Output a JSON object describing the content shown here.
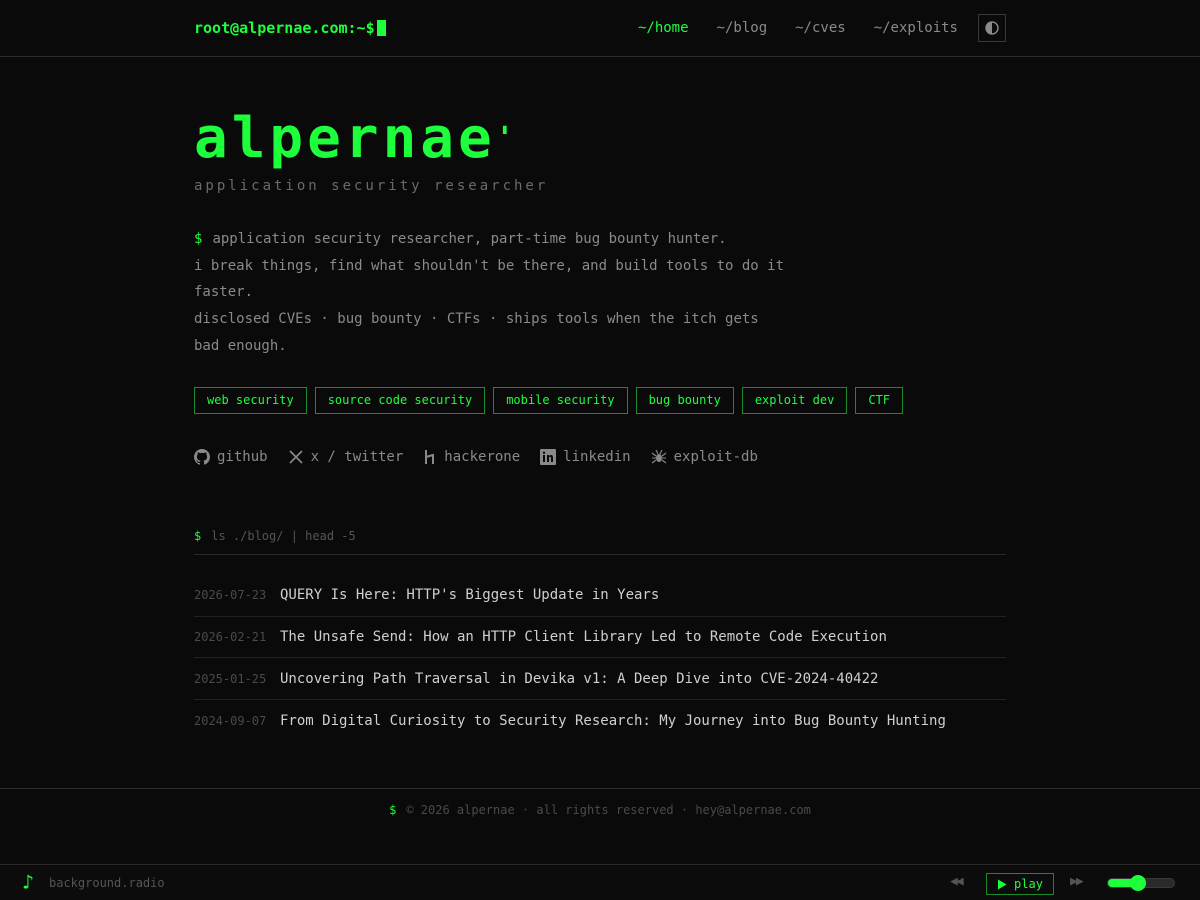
{
  "header": {
    "prompt": "root@alpernae.com:~$",
    "nav": [
      {
        "label": "~/home",
        "active": true
      },
      {
        "label": "~/blog",
        "active": false
      },
      {
        "label": "~/cves",
        "active": false
      },
      {
        "label": "~/exploits",
        "active": false
      }
    ],
    "theme_icon": "half-circle-contrast-icon"
  },
  "hero": {
    "title": "alpernae",
    "subtitle": "application security researcher",
    "bio_prompt": "$",
    "bio_line1": "application security researcher, part-time bug bounty hunter.",
    "bio_line2": "i break things, find what shouldn't be there, and build tools to do it faster.",
    "bio_line3": "disclosed CVEs · bug bounty · CTFs · ships tools when the itch gets bad enough."
  },
  "tags": [
    "web security",
    "source code security",
    "mobile security",
    "bug bounty",
    "exploit dev",
    "CTF"
  ],
  "socials": [
    {
      "label": "github",
      "icon": "github-icon"
    },
    {
      "label": "x / twitter",
      "icon": "x-icon"
    },
    {
      "label": "hackerone",
      "icon": "hackerone-icon"
    },
    {
      "label": "linkedin",
      "icon": "linkedin-icon"
    },
    {
      "label": "exploit-db",
      "icon": "exploit-db-icon"
    }
  ],
  "blog": {
    "prompt": "$",
    "command": "ls ./blog/ | head -5",
    "posts": [
      {
        "date": "2026-07-23",
        "title": "QUERY Is Here: HTTP's Biggest Update in Years"
      },
      {
        "date": "2026-02-21",
        "title": "The Unsafe Send: How an HTTP Client Library Led to Remote Code Execution"
      },
      {
        "date": "2025-01-25",
        "title": "Uncovering Path Traversal in Devika v1: A Deep Dive into CVE-2024-40422"
      },
      {
        "date": "2024-09-07",
        "title": "From Digital Curiosity to Security Research: My Journey into Bug Bounty Hunting"
      }
    ]
  },
  "footer": {
    "prompt": "$",
    "text": "© 2026 alpernae · all rights reserved · hey@alpernae.com"
  },
  "player": {
    "label": "background.radio",
    "prev": "◀◀",
    "play": "play",
    "next": "▶▶",
    "volume": 0.45
  },
  "colors": {
    "accent": "#1eff3c",
    "background": "#0a0a0a"
  }
}
